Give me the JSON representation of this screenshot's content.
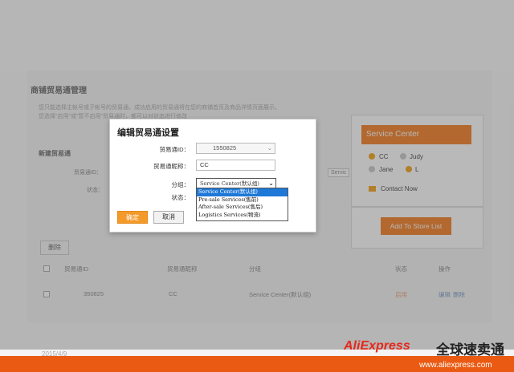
{
  "page": {
    "title": "商铺贸易通管理",
    "desc_line1": "您只能选择主帐号或子帐号的贸易通。成功启用的贸易通将在您的商铺首页及商品详情页面展示。",
    "desc_line2": "您选择\"启用\"或\"暂不启用\"贸易通时，都可以对状态进行修改",
    "form_title": "新建贸易通",
    "form_id_label": "贸易通ID：",
    "form_status_label": "状态：",
    "form_service_hint": "Servic"
  },
  "table": {
    "delete_label": "删除",
    "headers": [
      "贸易通ID",
      "贸易通昵称",
      "分组",
      "状态",
      "操作"
    ],
    "rows": [
      {
        "id": "350825",
        "nickname": "CC",
        "group": "Service Center(默认组)",
        "status": "启用",
        "action_edit": "编辑",
        "action_delete": "删除"
      }
    ]
  },
  "service_card": {
    "title": "Service Center",
    "members": [
      "CC",
      "Judy",
      "Jane",
      "L"
    ],
    "contact": "Contact Now",
    "add_store": "Add To Store List"
  },
  "dialog": {
    "title": "编辑贸易通设置",
    "id_label": "贸易通ID：",
    "id_value": "1550825",
    "nickname_label": "贸易通昵称：",
    "nickname_value": "CC",
    "group_label": "分组：",
    "group_selected": "Service Center(默认组)",
    "status_label": "状态：",
    "group_options": [
      "Service Center(默认组)",
      "Pre-sale Services(售前)",
      "After-sale Services(售后)",
      "Logistics Services(物流)"
    ],
    "confirm_label": "确定",
    "cancel_label": "取消"
  },
  "footer": {
    "date": "2015/4/9",
    "logo": "AliExpress",
    "logo_cn": "全球速卖通",
    "url": "www.aliexpress.com"
  },
  "colors": {
    "accent": "#f47c20",
    "confirm": "#f39a2b",
    "select_highlight": "#1e78d7",
    "footer_bar": "#ea5a12"
  }
}
